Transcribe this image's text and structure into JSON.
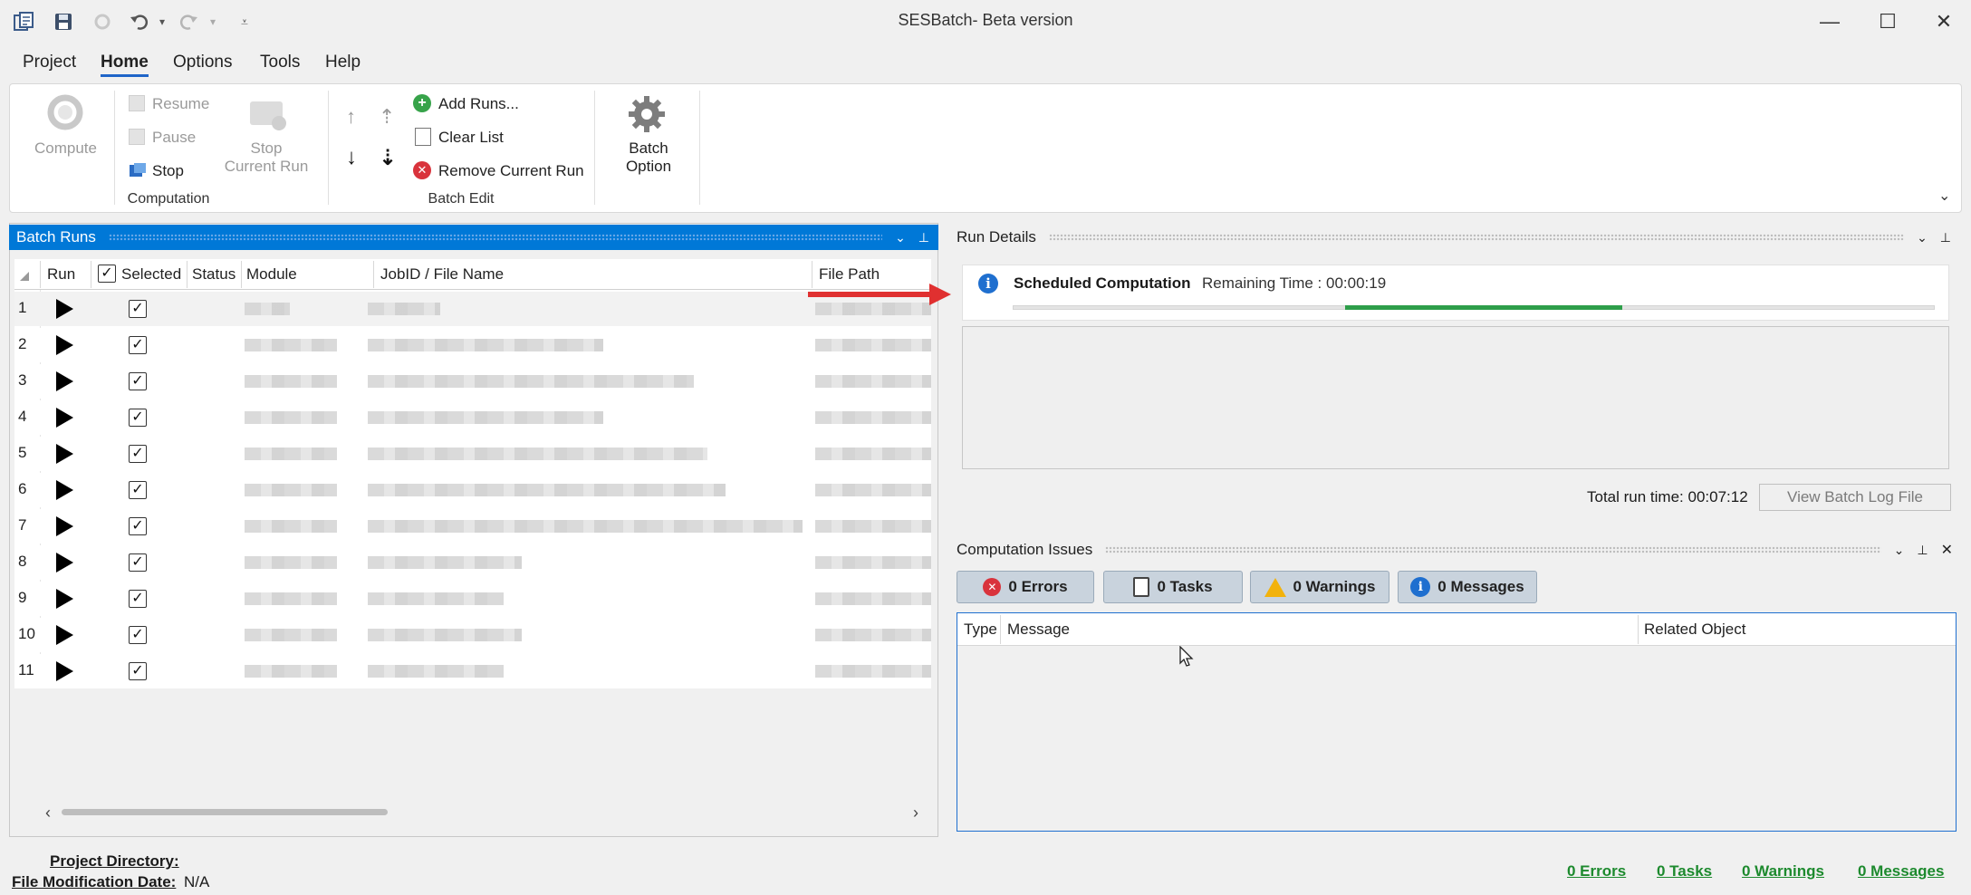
{
  "window": {
    "title": "SESBatch- Beta version",
    "minimize": "—",
    "maximize": "☐",
    "close": "✕"
  },
  "menu": [
    "Project",
    "Home",
    "Options",
    "Tools",
    "Help"
  ],
  "ribbon": {
    "compute": "Compute",
    "resume": "Resume",
    "pause": "Pause",
    "stop": "Stop",
    "stop_current_line1": "Stop",
    "stop_current_line2": "Current Run",
    "computation_group": "Computation",
    "add_runs": "Add Runs...",
    "clear_list": "Clear List",
    "remove_current_run": "Remove Current Run",
    "batch_edit_group": "Batch Edit",
    "batch_option_line1": "Batch",
    "batch_option_line2": "Option"
  },
  "batch_runs": {
    "title": "Batch Runs",
    "columns": {
      "run": "Run",
      "selected": "Selected",
      "status": "Status",
      "module": "Module",
      "jobid": "JobID / File Name",
      "filepath": "File Path"
    },
    "rows": [
      "1",
      "2",
      "3",
      "4",
      "5",
      "6",
      "7",
      "8",
      "9",
      "10",
      "11"
    ]
  },
  "run_details": {
    "title": "Run Details",
    "status_title": "Scheduled Computation",
    "remaining": "Remaining Time : 00:00:19",
    "progress": 0.3,
    "total_run_time": "Total run time: 00:07:12",
    "view_log": "View Batch Log File"
  },
  "issues": {
    "title": "Computation Issues",
    "errors": "0 Errors",
    "tasks": "0 Tasks",
    "warnings": "0 Warnings",
    "messages": "0 Messages",
    "columns": {
      "type": "Type",
      "message": "Message",
      "related": "Related Object"
    }
  },
  "statusbar": {
    "project_dir_label": "Project Directory:",
    "file_mod_label": "File Modification Date:",
    "file_mod_value": "N/A",
    "errors": "0 Errors",
    "tasks": "0 Tasks",
    "warnings": "0 Warnings",
    "messages": "0 Messages"
  },
  "colors": {
    "accent": "#0078d7",
    "progress": "#2e9e4a",
    "arrow": "#e03030",
    "link": "#1d8a2e"
  }
}
